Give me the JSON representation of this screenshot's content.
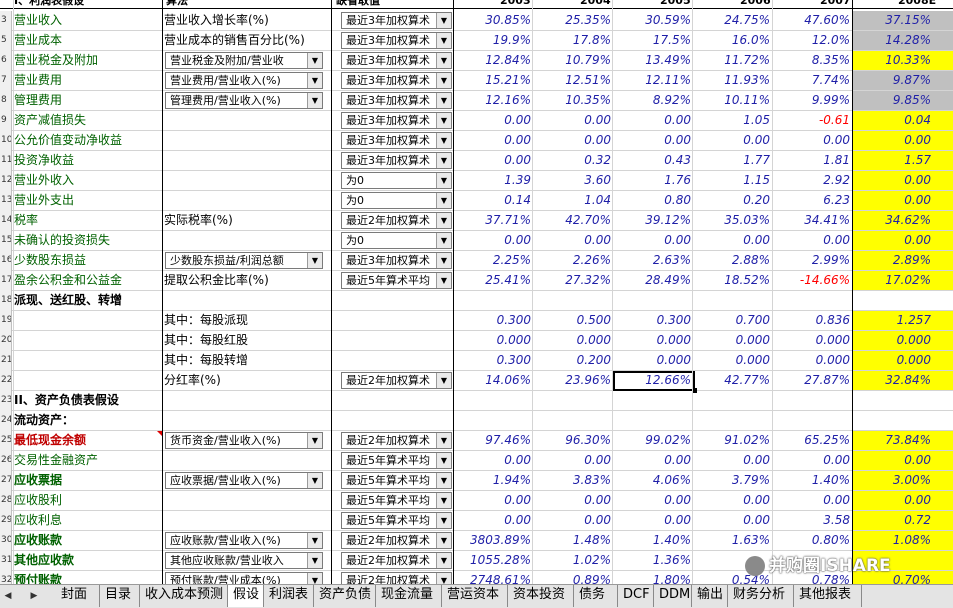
{
  "headers": {
    "sectionA": "I、利润表假设",
    "method": "算法",
    "defaultValue": "缺省取值",
    "years": [
      "2003",
      "2004",
      "2005",
      "2006",
      "2007",
      "2008E"
    ]
  },
  "rows": [
    {
      "rn": "3",
      "label": "营业收入",
      "labelStyle": "green",
      "algo": "营业收入增长率(%)",
      "method": "最近3年加权算术",
      "vals": [
        "30.85%",
        "25.35%",
        "30.59%",
        "24.75%",
        "47.60%",
        "37.15%"
      ],
      "proj": "gray"
    },
    {
      "rn": "5",
      "label": "营业成本",
      "labelStyle": "green",
      "algo": "营业成本的销售百分比(%)",
      "method": "最近3年加权算术",
      "vals": [
        "19.9%",
        "17.8%",
        "17.5%",
        "16.0%",
        "12.0%",
        "14.28%"
      ],
      "proj": "gray"
    },
    {
      "rn": "6",
      "label": "营业税金及附加",
      "labelStyle": "green",
      "algoDD": "营业税金及附加/营业收",
      "method": "最近3年加权算术",
      "vals": [
        "12.84%",
        "10.79%",
        "13.49%",
        "11.72%",
        "8.35%",
        "10.33%"
      ],
      "proj": "yellow"
    },
    {
      "rn": "7",
      "label": "营业费用",
      "labelStyle": "green",
      "algoDD": "营业费用/营业收入(%)",
      "method": "最近3年加权算术",
      "vals": [
        "15.21%",
        "12.51%",
        "12.11%",
        "11.93%",
        "7.74%",
        "9.87%"
      ],
      "proj": "gray"
    },
    {
      "rn": "8",
      "label": "管理费用",
      "labelStyle": "green",
      "algoDD": "管理费用/营业收入(%)",
      "method": "最近3年加权算术",
      "vals": [
        "12.16%",
        "10.35%",
        "8.92%",
        "10.11%",
        "9.99%",
        "9.85%"
      ],
      "proj": "gray"
    },
    {
      "rn": "9",
      "label": "资产减值损失",
      "labelStyle": "green",
      "method": "最近3年加权算术",
      "vals": [
        "0.00",
        "0.00",
        "0.00",
        "1.05",
        "-0.61",
        "0.04"
      ],
      "proj": "yellow"
    },
    {
      "rn": "10",
      "label": "公允价值变动净收益",
      "labelStyle": "green",
      "method": "最近3年加权算术",
      "vals": [
        "0.00",
        "0.00",
        "0.00",
        "0.00",
        "0.00",
        "0.00"
      ],
      "proj": "yellow"
    },
    {
      "rn": "11",
      "label": "投资净收益",
      "labelStyle": "green",
      "method": "最近3年加权算术",
      "vals": [
        "0.00",
        "0.32",
        "0.43",
        "1.77",
        "1.81",
        "1.57"
      ],
      "proj": "yellow"
    },
    {
      "rn": "12",
      "label": "营业外收入",
      "labelStyle": "green",
      "method": "为0",
      "vals": [
        "1.39",
        "3.60",
        "1.76",
        "1.15",
        "2.92",
        "0.00"
      ],
      "proj": "yellow"
    },
    {
      "rn": "13",
      "label": "营业外支出",
      "labelStyle": "green",
      "method": "为0",
      "vals": [
        "0.14",
        "1.04",
        "0.80",
        "0.20",
        "6.23",
        "0.00"
      ],
      "proj": "yellow"
    },
    {
      "rn": "14",
      "label": "税率",
      "labelStyle": "green",
      "algo": "实际税率(%)",
      "method": "最近2年加权算术",
      "vals": [
        "37.71%",
        "42.70%",
        "39.12%",
        "35.03%",
        "34.41%",
        "34.62%"
      ],
      "proj": "yellow"
    },
    {
      "rn": "15",
      "label": "未确认的投资损失",
      "labelStyle": "green",
      "method": "为0",
      "vals": [
        "0.00",
        "0.00",
        "0.00",
        "0.00",
        "0.00",
        "0.00"
      ],
      "proj": "yellow"
    },
    {
      "rn": "16",
      "label": "少数股东损益",
      "labelStyle": "green",
      "algoDD": "少数股东损益/利润总额",
      "method": "最近3年加权算术",
      "vals": [
        "2.25%",
        "2.26%",
        "2.63%",
        "2.88%",
        "2.99%",
        "2.89%"
      ],
      "proj": "yellow"
    },
    {
      "rn": "17",
      "label": "盈余公积金和公益金",
      "labelStyle": "green",
      "algo": "提取公积金比率(%)",
      "method": "最近5年算术平均",
      "vals": [
        "25.41%",
        "27.32%",
        "28.49%",
        "18.52%",
        "-14.66%",
        "17.02%"
      ],
      "proj": "yellow"
    },
    {
      "rn": "18",
      "label": "派现、送红股、转增",
      "labelStyle": "bold",
      "vals": [
        "",
        "",
        "",
        "",
        "",
        ""
      ],
      "proj": "none"
    },
    {
      "rn": "19",
      "label": "",
      "algo": "其中：每股派现",
      "vals": [
        "0.300",
        "0.500",
        "0.300",
        "0.700",
        "0.836",
        "1.257"
      ],
      "proj": "yellow"
    },
    {
      "rn": "20",
      "label": "",
      "algo": "其中：每股红股",
      "vals": [
        "0.000",
        "0.000",
        "0.000",
        "0.000",
        "0.000",
        "0.000"
      ],
      "proj": "yellow"
    },
    {
      "rn": "21",
      "label": "",
      "algo": "其中：每股转增",
      "vals": [
        "0.300",
        "0.200",
        "0.000",
        "0.000",
        "0.000",
        "0.000"
      ],
      "proj": "yellow"
    },
    {
      "rn": "22",
      "label": "",
      "algo": "分红率(%)",
      "method": "最近2年加权算术",
      "vals": [
        "14.06%",
        "23.96%",
        "12.66%",
        "42.77%",
        "27.87%",
        "32.84%"
      ],
      "proj": "yellow",
      "selected": 2
    },
    {
      "rn": "23",
      "label": "II、资产负债表假设",
      "labelStyle": "bold",
      "vals": [
        "",
        "",
        "",
        "",
        "",
        ""
      ],
      "proj": "none"
    },
    {
      "rn": "24",
      "label": "流动资产：",
      "labelStyle": "bold",
      "vals": [
        "",
        "",
        "",
        "",
        "",
        ""
      ],
      "proj": "none"
    },
    {
      "rn": "25",
      "label": "最低现金余额",
      "labelStyle": "red",
      "algoDD": "货币资金/营业收入(%)",
      "method": "最近2年加权算术",
      "vals": [
        "97.46%",
        "96.30%",
        "99.02%",
        "91.02%",
        "65.25%",
        "73.84%"
      ],
      "proj": "yellow",
      "comment": true
    },
    {
      "rn": "26",
      "label": "交易性金融资产",
      "labelStyle": "green",
      "method": "最近5年算术平均",
      "vals": [
        "0.00",
        "0.00",
        "0.00",
        "0.00",
        "0.00",
        "0.00"
      ],
      "proj": "yellow"
    },
    {
      "rn": "27",
      "label": "应收票据",
      "labelStyle": "boldgreen",
      "algoDD": "应收票据/营业收入(%)",
      "method": "最近5年算术平均",
      "vals": [
        "1.94%",
        "3.83%",
        "4.06%",
        "3.79%",
        "1.40%",
        "3.00%"
      ],
      "proj": "yellow"
    },
    {
      "rn": "28",
      "label": "应收股利",
      "labelStyle": "green",
      "method": "最近5年算术平均",
      "vals": [
        "0.00",
        "0.00",
        "0.00",
        "0.00",
        "0.00",
        "0.00"
      ],
      "proj": "yellow"
    },
    {
      "rn": "29",
      "label": "应收利息",
      "labelStyle": "green",
      "method": "最近5年算术平均",
      "vals": [
        "0.00",
        "0.00",
        "0.00",
        "0.00",
        "3.58",
        "0.72"
      ],
      "proj": "yellow"
    },
    {
      "rn": "30",
      "label": "应收账款",
      "labelStyle": "boldgreen",
      "algoDD": "应收账款/营业收入(%)",
      "method": "最近2年加权算术",
      "vals": [
        "3803.89%",
        "1.48%",
        "1.40%",
        "1.63%",
        "0.80%",
        "1.08%"
      ],
      "proj": "yellow"
    },
    {
      "rn": "31",
      "label": "其他应收款",
      "labelStyle": "boldgreen",
      "algoDD": "其他应收账款/营业收入",
      "method": "最近2年加权算术",
      "vals": [
        "1055.28%",
        "1.02%",
        "1.36%",
        "",
        "",
        ""
      ],
      "proj": "yellow"
    },
    {
      "rn": "32",
      "label": "预付账款",
      "labelStyle": "boldgreen",
      "algoDD": "预付账款/营业成本(%)",
      "method": "最近2年加权算术",
      "vals": [
        "2748.61%",
        "0.89%",
        "1.80%",
        "0.54%",
        "0.78%",
        "0.70%"
      ],
      "proj": "yellow"
    }
  ],
  "tabs": [
    "封面",
    "目录",
    "收入成本预测",
    "假设",
    "利润表",
    "资产负债",
    "现金流量",
    "营运资本",
    "资本投资",
    "债务",
    "DCF",
    "DDM",
    "输出",
    "财务分析",
    "其他报表"
  ],
  "activeTab": "假设",
  "watermark": "并购圈ISHARE",
  "colors": {
    "projYellow": "#ffff00",
    "projGray": "#c0c0c0",
    "valueBlue": "#1f1fa8",
    "labelGreen": "#006100",
    "negRed": "#ff0000"
  }
}
